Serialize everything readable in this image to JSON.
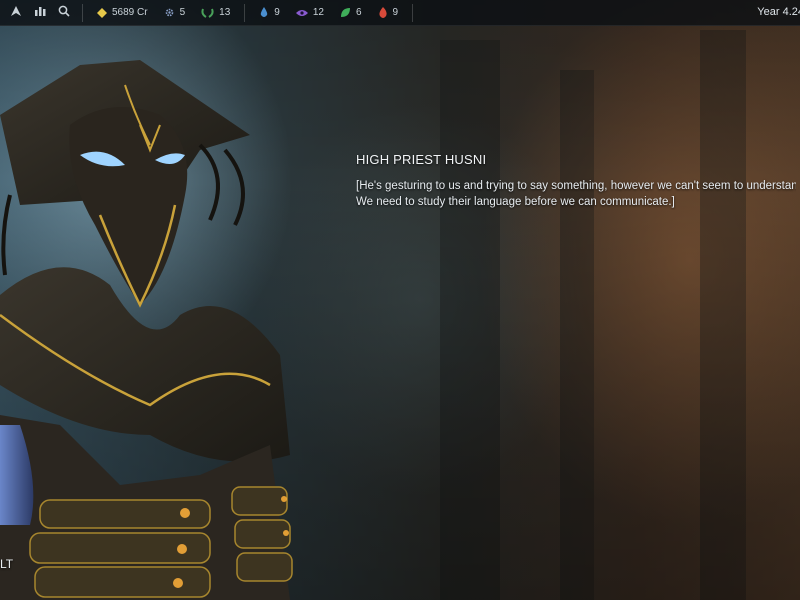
{
  "topbar": {
    "icons": [
      "fleet-icon",
      "empire-stats-icon",
      "search-icon"
    ],
    "resources": [
      {
        "name": "credits",
        "value": "5689 Cr",
        "icon": "diamond-icon",
        "color": "#e6c84a"
      },
      {
        "name": "research",
        "value": "5",
        "icon": "gear-icon",
        "color": "#8aa0c8"
      },
      {
        "name": "influence",
        "value": "13",
        "icon": "laurel-icon",
        "color": "#49a15a"
      },
      {
        "name": "strategic-1",
        "value": "9",
        "icon": "drop-icon",
        "color": "#4a8fd0"
      },
      {
        "name": "strategic-2",
        "value": "12",
        "icon": "eye-icon",
        "color": "#8a5bd0"
      },
      {
        "name": "strategic-3",
        "value": "6",
        "icon": "leaf-icon",
        "color": "#3fae5a"
      },
      {
        "name": "strategic-4",
        "value": "9",
        "icon": "flame-icon",
        "color": "#d84a3a"
      }
    ],
    "year": "Year 4.24"
  },
  "dialogue": {
    "speaker": "HIGH PRIEST HUSNI",
    "line1": "[He's gesturing to us and trying to say something, however we can't seem to understand.",
    "line2": "We need to study their language before we can communicate.]"
  },
  "bottom_left_label": "LT",
  "colors": {
    "accent_gold": "#c9a23a",
    "bar_bg": "#0c1014"
  }
}
